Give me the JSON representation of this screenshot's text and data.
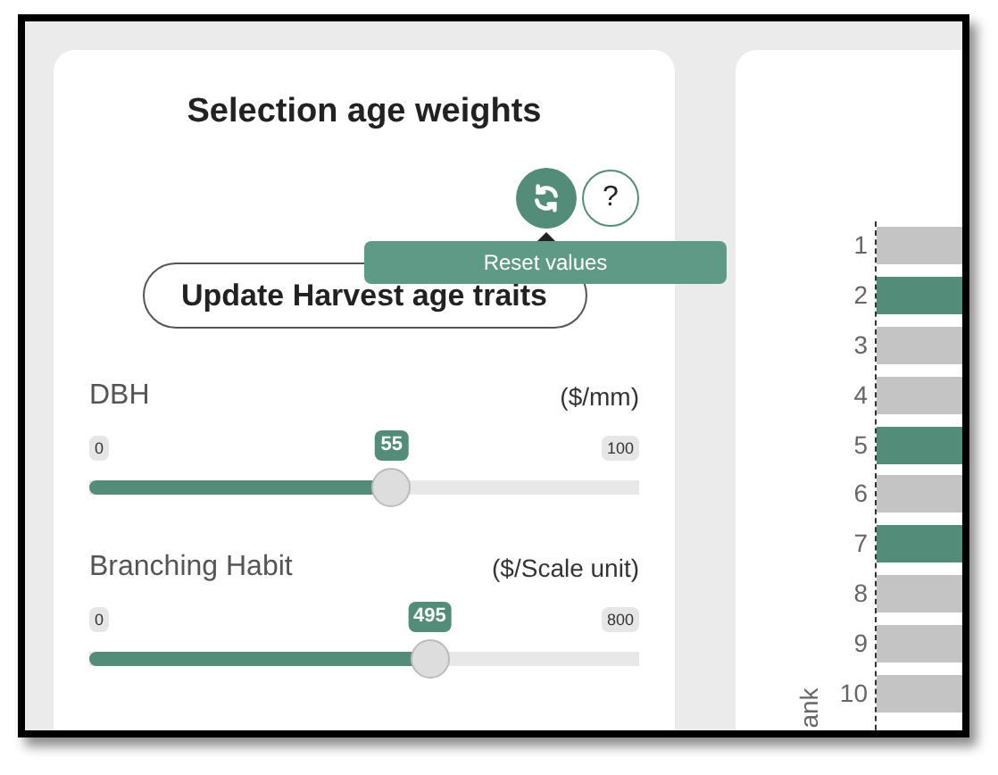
{
  "panel": {
    "title": "Selection age weights",
    "tooltip": "Reset values",
    "help_button": "?",
    "update_button": "Update Harvest age traits"
  },
  "sliders": [
    {
      "label": "DBH",
      "unit": "($/mm)",
      "min": "0",
      "max": "100",
      "value": "55",
      "level": 0.55
    },
    {
      "label": "Branching Habit",
      "unit": "($/Scale unit)",
      "min": "0",
      "max": "800",
      "value": "495",
      "level": 0.619
    }
  ],
  "rank_chart": {
    "axis_title": "ank",
    "bars": [
      {
        "label": "1",
        "color": "#c4c4c4"
      },
      {
        "label": "2",
        "color": "#548c7a"
      },
      {
        "label": "3",
        "color": "#c4c4c4"
      },
      {
        "label": "4",
        "color": "#c4c4c4"
      },
      {
        "label": "5",
        "color": "#548c7a"
      },
      {
        "label": "6",
        "color": "#c4c4c4"
      },
      {
        "label": "7",
        "color": "#548c7a"
      },
      {
        "label": "8",
        "color": "#c4c4c4"
      },
      {
        "label": "9",
        "color": "#c4c4c4"
      },
      {
        "label": "10",
        "color": "#c4c4c4"
      }
    ]
  }
}
